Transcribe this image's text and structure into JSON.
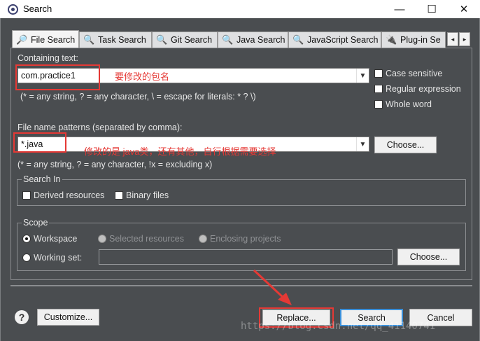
{
  "window": {
    "title": "Search",
    "minimize": "—",
    "maximize": "☐",
    "close": "✕"
  },
  "tabs": [
    {
      "label": "File Search",
      "icon": "file-search-icon"
    },
    {
      "label": "Task Search",
      "icon": "task-search-icon"
    },
    {
      "label": "Git Search",
      "icon": "git-search-icon"
    },
    {
      "label": "Java Search",
      "icon": "java-search-icon"
    },
    {
      "label": "JavaScript Search",
      "icon": "javascript-search-icon"
    },
    {
      "label": "Plug-in Se",
      "icon": "plugin-search-icon"
    }
  ],
  "tab_nav": {
    "prev": "◂",
    "next": "▸"
  },
  "containing": {
    "label": "Containing text:",
    "value": "com.practice1",
    "hint": "(* = any string, ? = any character, \\ = escape for literals: * ? \\)"
  },
  "options": {
    "case_sensitive": "Case sensitive",
    "regex": "Regular expression",
    "whole_word": "Whole word"
  },
  "file_patterns": {
    "label": "File name patterns (separated by comma):",
    "value": "*.java",
    "choose": "Choose...",
    "hint": "(* = any string, ? = any character, !x = excluding x)"
  },
  "search_in": {
    "title": "Search In",
    "derived": "Derived resources",
    "binary": "Binary files"
  },
  "scope": {
    "title": "Scope",
    "workspace": "Workspace",
    "selected": "Selected resources",
    "enclosing": "Enclosing projects",
    "working_set": "Working set:",
    "choose": "Choose..."
  },
  "annotations": {
    "package": "要修改的包名",
    "filetype": "修改的是 java类，还有其他，自行根据需要选择"
  },
  "buttons": {
    "help": "?",
    "customize": "Customize...",
    "replace": "Replace...",
    "search": "Search",
    "cancel": "Cancel"
  },
  "watermark": "https://blog.csdn.net/qq_41140741",
  "colors": {
    "dialog_bg": "#4a4d50",
    "annotation_red": "#e53935",
    "default_button": "#3b8fd9"
  }
}
